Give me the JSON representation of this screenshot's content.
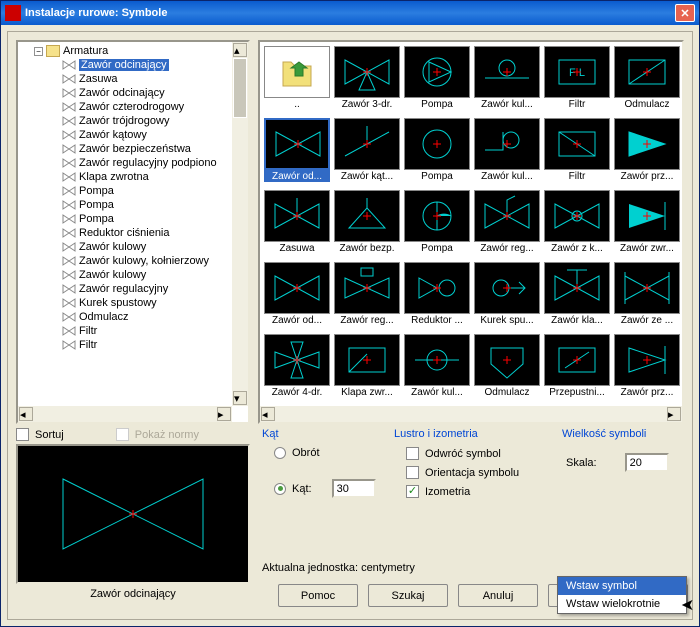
{
  "window": {
    "title": "Instalacje rurowe: Symbole"
  },
  "tree": {
    "root": "Armatura",
    "items": [
      "Zawór odcinający",
      "Zasuwa",
      "Zawór odcinający",
      "Zawór czterodrogowy",
      "Zawór trójdrogowy",
      "Zawór kątowy",
      "Zawór bezpieczeństwa",
      "Zawór regulacyjny podpiono",
      "Klapa zwrotna",
      "Pompa",
      "Pompa",
      "Pompa",
      "Reduktor ciśnienia",
      "Zawór kulowy",
      "Zawór kulowy, kołnierzowy",
      "Zawór kulowy",
      "Zawór regulacyjny",
      "Kurek spustowy",
      "Odmulacz",
      "Filtr",
      "Filtr"
    ],
    "selected_index": 0
  },
  "grid": {
    "cells": [
      {
        "label": "..",
        "first": true
      },
      {
        "label": "Zawór 3-dr.",
        "shape": "3way"
      },
      {
        "label": "Pompa",
        "shape": "pump1"
      },
      {
        "label": "Zawór kul...",
        "shape": "ball"
      },
      {
        "label": "Filtr",
        "shape": "filter1"
      },
      {
        "label": "Odmulacz",
        "shape": "strainer"
      },
      {
        "label": "Zawór od...",
        "shape": "bowtie",
        "selected": true
      },
      {
        "label": "Zawór kąt...",
        "shape": "angle"
      },
      {
        "label": "Pompa",
        "shape": "pump2"
      },
      {
        "label": "Zawór kul...",
        "shape": "ball2"
      },
      {
        "label": "Filtr",
        "shape": "filter2"
      },
      {
        "label": "Zawór prz...",
        "shape": "tri"
      },
      {
        "label": "Zasuwa",
        "shape": "gate"
      },
      {
        "label": "Zawór bezp.",
        "shape": "safety"
      },
      {
        "label": "Pompa",
        "shape": "pump3"
      },
      {
        "label": "Zawór reg...",
        "shape": "reg"
      },
      {
        "label": "Zawór z k...",
        "shape": "ballflange"
      },
      {
        "label": "Zawór zwr...",
        "shape": "check"
      },
      {
        "label": "Zawór od...",
        "shape": "bowtie2"
      },
      {
        "label": "Zawór reg...",
        "shape": "reg2"
      },
      {
        "label": "Reduktor ...",
        "shape": "reducer"
      },
      {
        "label": "Kurek spu...",
        "shape": "drain"
      },
      {
        "label": "Zawór kla...",
        "shape": "flap"
      },
      {
        "label": "Zawór ze ...",
        "shape": "zwr2"
      },
      {
        "label": "Zawór 4-dr.",
        "shape": "4way"
      },
      {
        "label": "Klapa zwr...",
        "shape": "checkflap"
      },
      {
        "label": "Zawór kul...",
        "shape": "ball3"
      },
      {
        "label": "Odmulacz",
        "shape": "strainer2"
      },
      {
        "label": "Przepustni...",
        "shape": "damper"
      },
      {
        "label": "Zawór prz...",
        "shape": "tri2"
      }
    ]
  },
  "sort": {
    "sort_label": "Sortuj",
    "norms_label": "Pokaż normy"
  },
  "preview": {
    "label": "Zawór odcinający"
  },
  "angle": {
    "title": "Kąt",
    "rotate_label": "Obrót",
    "angle_label": "Kąt:",
    "value": "30"
  },
  "mirror": {
    "title": "Lustro i izometria",
    "flip_label": "Odwróć symbol",
    "orient_label": "Orientacja symbolu",
    "iso_label": "Izometria"
  },
  "size": {
    "title": "Wielkość symboli",
    "scale_label": "Skala:",
    "value": "20"
  },
  "units": {
    "label": "Aktualna jednostka: centymetry"
  },
  "buttons": {
    "help": "Pomoc",
    "search": "Szukaj",
    "cancel": "Anuluj",
    "insert": "Wstaw symbol"
  },
  "menu": {
    "item1": "Wstaw symbol",
    "item2": "Wstaw wielokrotnie"
  }
}
